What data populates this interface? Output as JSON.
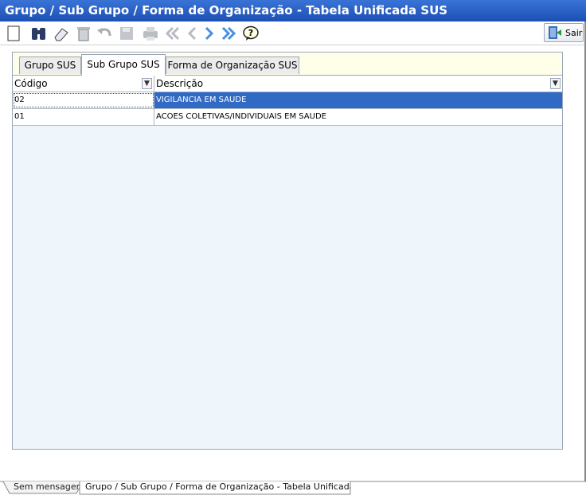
{
  "window": {
    "title": "Grupo / Sub Grupo  / Forma de Organização - Tabela Unificada SUS"
  },
  "toolbar": {
    "sair_label": "Sair"
  },
  "tabs": [
    {
      "label": "Grupo SUS"
    },
    {
      "label": "Sub Grupo SUS"
    },
    {
      "label": "Forma de Organização SUS"
    }
  ],
  "grid": {
    "headers": {
      "codigo": "Código",
      "descricao": "Descrição"
    },
    "rows": [
      {
        "codigo": "02",
        "descricao": "VIGILANCIA EM SAUDE"
      },
      {
        "codigo": "01",
        "descricao": "ACOES COLETIVAS/INDIVIDUAIS EM SAUDE"
      }
    ]
  },
  "status_tabs": [
    {
      "label": "Sem mensagens"
    },
    {
      "label": "Grupo / Sub Grupo  / Forma de Organização - Tabela Unificada SUS"
    }
  ]
}
